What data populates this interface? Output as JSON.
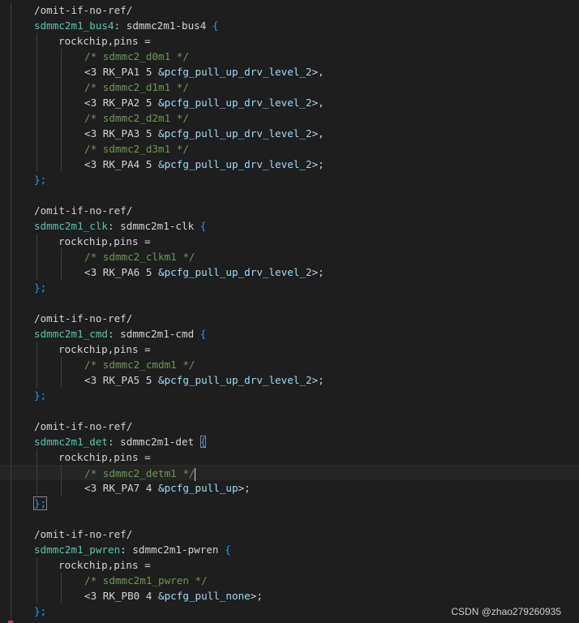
{
  "colors": {
    "background": "#1e1e1e",
    "text": "#d4d4d4",
    "label": "#4ec9b0",
    "comment": "#6a9955",
    "reference": "#9cdcfe",
    "brace": "#179fff"
  },
  "blocks": [
    {
      "directive": "/omit-if-no-ref/",
      "label": "sdmmc2m1_bus4",
      "node": "sdmmc2m1-bus4",
      "property": "rockchip,pins =",
      "entries": [
        {
          "comment": "/* sdmmc2_d0m1 */",
          "cell": "<3 RK_PA1 5 ",
          "ref": "&pcfg_pull_up_drv_level_2",
          "end": ">,"
        },
        {
          "comment": "/* sdmmc2_d1m1 */",
          "cell": "<3 RK_PA2 5 ",
          "ref": "&pcfg_pull_up_drv_level_2",
          "end": ">,"
        },
        {
          "comment": "/* sdmmc2_d2m1 */",
          "cell": "<3 RK_PA3 5 ",
          "ref": "&pcfg_pull_up_drv_level_2",
          "end": ">,"
        },
        {
          "comment": "/* sdmmc2_d3m1 */",
          "cell": "<3 RK_PA4 5 ",
          "ref": "&pcfg_pull_up_drv_level_2",
          "end": ">;"
        }
      ]
    },
    {
      "directive": "/omit-if-no-ref/",
      "label": "sdmmc2m1_clk",
      "node": "sdmmc2m1-clk",
      "property": "rockchip,pins =",
      "entries": [
        {
          "comment": "/* sdmmc2_clkm1 */",
          "cell": "<3 RK_PA6 5 ",
          "ref": "&pcfg_pull_up_drv_level_2",
          "end": ">;"
        }
      ]
    },
    {
      "directive": "/omit-if-no-ref/",
      "label": "sdmmc2m1_cmd",
      "node": "sdmmc2m1-cmd",
      "property": "rockchip,pins =",
      "entries": [
        {
          "comment": "/* sdmmc2_cmdm1 */",
          "cell": "<3 RK_PA5 5 ",
          "ref": "&pcfg_pull_up_drv_level_2",
          "end": ">;"
        }
      ]
    },
    {
      "directive": "/omit-if-no-ref/",
      "label": "sdmmc2m1_det",
      "node": "sdmmc2m1-det",
      "property": "rockchip,pins =",
      "entries": [
        {
          "comment": "/* sdmmc2_detm1 */",
          "cell": "<3 RK_PA7 4 ",
          "ref": "&pcfg_pull_up",
          "end": ">;"
        }
      ]
    },
    {
      "directive": "/omit-if-no-ref/",
      "label": "sdmmc2m1_pwren",
      "node": "sdmmc2m1-pwren",
      "property": "rockchip,pins =",
      "entries": [
        {
          "comment": "/* sdmmc2m1_pwren */",
          "cell": "<3 RK_PB0 4 ",
          "ref": "&pcfg_pull_none",
          "end": ">;"
        }
      ]
    }
  ],
  "syntax": {
    "open_brace": "{",
    "close_brace": "};",
    "label_sep": ": ",
    "space": " "
  },
  "watermark": "CSDN @zhao279260935"
}
